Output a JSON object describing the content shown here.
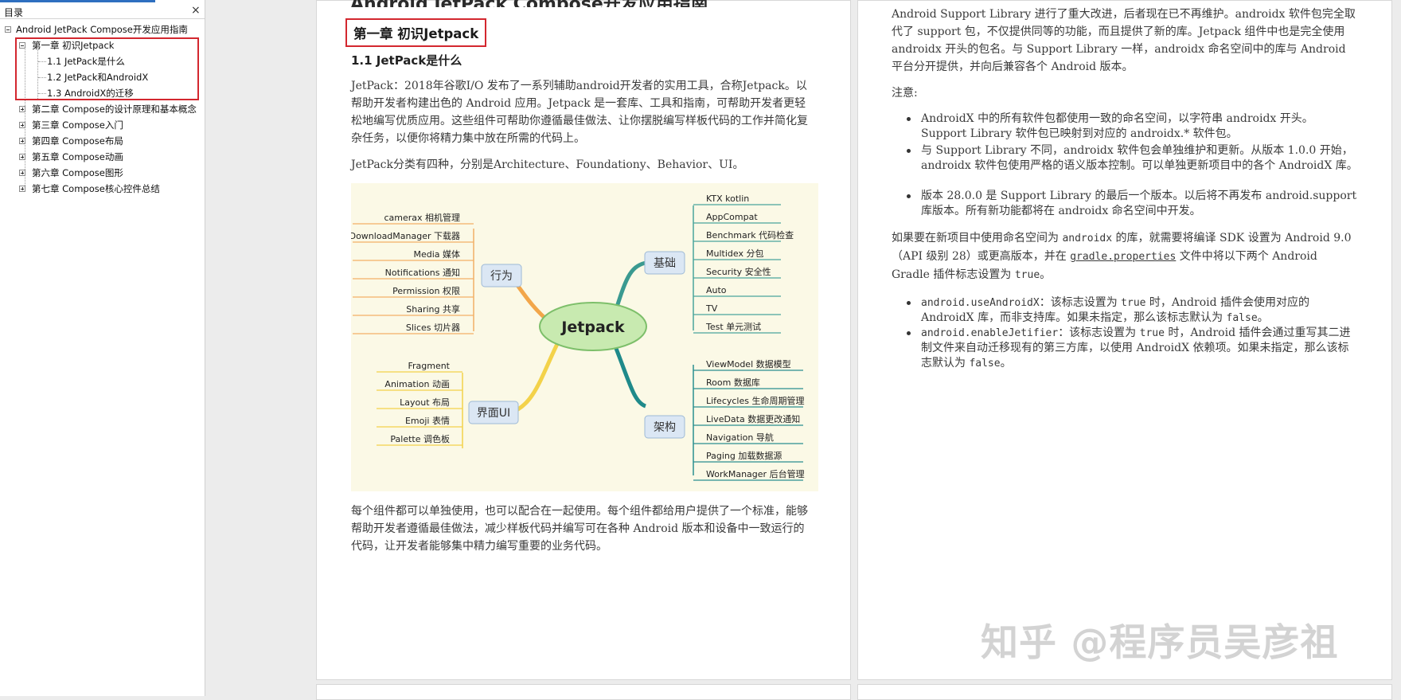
{
  "toc": {
    "title": "目录",
    "close_glyph": "×",
    "root": "Android JetPack Compose开发应用指南",
    "chapter1": "第一章 初识Jetpack",
    "sub1": "1.1 JetPack是什么",
    "sub2": "1.2 JetPack和AndroidX",
    "sub3": "1.3 AndroidX的迁移",
    "chapter2": "第二章 Compose的设计原理和基本概念",
    "chapter3": "第三章 Compose入门",
    "chapter4": "第四章 Compose布局",
    "chapter5": "第五章 Compose动画",
    "chapter6": "第六章 Compose图形",
    "chapter7": "第七章 Compose核心控件总结"
  },
  "page1": {
    "doc_title": "Android JetPack Compose开发应用指南",
    "chapter_heading": "第一章 初识Jetpack",
    "section_heading": "1.1 JetPack是什么",
    "para1": "JetPack：2018年谷歌I/O 发布了一系列辅助android开发者的实用工具，合称Jetpack。以帮助开发者构建出色的 Android 应用。Jetpack 是一套库、工具和指南，可帮助开发者更轻松地编写优质应用。这些组件可帮助你遵循最佳做法、让你摆脱编写样板代码的工作并简化复杂任务，以便你将精力集中放在所需的代码上。",
    "para2": "JetPack分类有四种，分别是Architecture、Foundationy、Behavior、UI。",
    "para3": "每个组件都可以单独使用，也可以配合在一起使用。每个组件都给用户提供了一个标准，能够帮助开发者遵循最佳做法，减少样板代码并编写可在各种 Android 版本和设备中一致运行的代码，让开发者能够集中精力编写重要的业务代码。",
    "mindmap": {
      "center": "Jetpack",
      "behavior": {
        "label": "行为",
        "items": [
          "camerax 相机管理",
          "DownloadManager 下载器",
          "Media 媒体",
          "Notifications 通知",
          "Permission 权限",
          "Sharing 共享",
          "Slices 切片器"
        ]
      },
      "ui": {
        "label": "界面UI",
        "items": [
          "Fragment",
          "Animation 动画",
          "Layout 布局",
          "Emoji 表情",
          "Palette 调色板"
        ]
      },
      "foundation": {
        "label": "基础",
        "items": [
          "KTX kotlin",
          "AppCompat",
          "Benchmark 代码检查",
          "Multidex 分包",
          "Security 安全性",
          "Auto",
          "TV",
          "Test 单元测试"
        ]
      },
      "architecture": {
        "label": "架构",
        "items": [
          "ViewModel 数据模型",
          "Room 数据库",
          "Lifecycles 生命周期管理",
          "LiveData 数据更改通知",
          "Navigation 导航",
          "Paging 加载数据源",
          "WorkManager 后台管理"
        ]
      }
    }
  },
  "page2": {
    "para1": "Android Support Library 进行了重大改进，后者现在已不再维护。androidx 软件包完全取代了 support 包，不仅提供同等的功能，而且提供了新的库。Jetpack 组件中也是完全使用 androidx 开头的包名。与 Support Library 一样，androidx 命名空间中的库与 Android 平台分开提供，并向后兼容各个 Android 版本。",
    "note": "注意:",
    "bullet1": "AndroidX 中的所有软件包都使用一致的命名空间，以字符串 androidx 开头。Support Library 软件包已映射到对应的 androidx.* 软件包。",
    "bullet2": "与 Support Library 不同，androidx 软件包会单独维护和更新。从版本 1.0.0 开始，androidx 软件包使用严格的语义版本控制。可以单独更新项目中的各个 AndroidX 库。",
    "bullet3": "版本 28.0.0 是 Support Library 的最后一个版本。以后将不再发布 android.support 库版本。所有新功能都将在 androidx 命名空间中开发。",
    "para2_a": "如果要在新项目中使用命名空间为 ",
    "para2_code1": "androidx",
    "para2_b": " 的库，就需要将编译 SDK 设置为 Android 9.0（API 级别 28）或更高版本，并在 ",
    "para2_code2": "gradle.properties",
    "para2_c": " 文件中将以下两个 Android Gradle 插件标志设置为 ",
    "para2_code3": "true",
    "para2_d": "。",
    "b4_code": "android.useAndroidX",
    "b4_a": "：该标志设置为 ",
    "b4_code2": "true",
    "b4_b": " 时，Android 插件会使用对应的 AndroidX 库，而非支持库。如果未指定，那么该标志默认为 ",
    "b4_code3": "false",
    "b4_c": "。",
    "b5_code": "android.enableJetifier",
    "b5_a": "：该标志设置为 ",
    "b5_code2": "true",
    "b5_b": " 时，Android 插件会通过重写其二进制文件来自动迁移现有的第三方库，以使用 AndroidX 依赖项。如果未指定，那么该标志默认为 ",
    "b5_code3": "false",
    "b5_c": "。"
  },
  "watermark": "知乎 @程序员吴彦祖",
  "colors": {
    "highlight": "#d3272f",
    "accent": "#2e6fc0",
    "mindmap_bg": "#fbf9e6"
  }
}
